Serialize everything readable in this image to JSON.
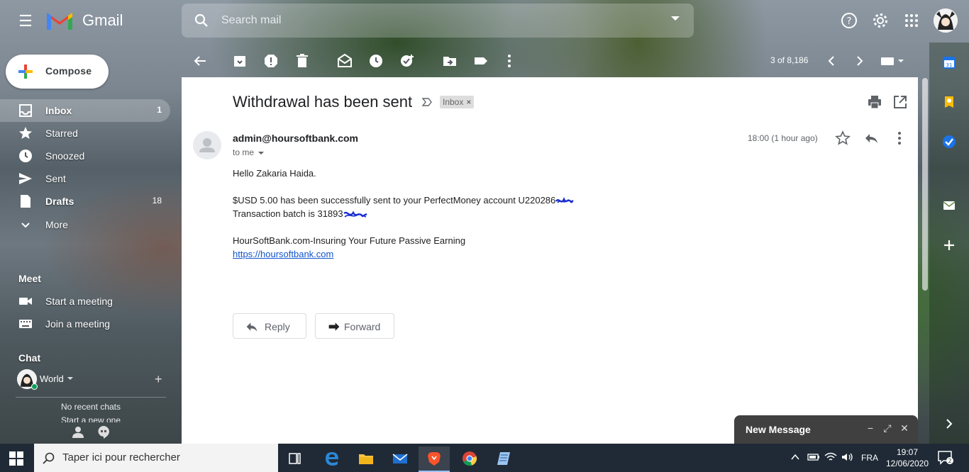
{
  "app": {
    "brand": "Gmail"
  },
  "search": {
    "placeholder": "Search mail"
  },
  "sidebar": {
    "compose": "Compose",
    "items": [
      {
        "label": "Inbox",
        "count": "1",
        "icon": "inbox-icon"
      },
      {
        "label": "Starred",
        "count": "",
        "icon": "star-icon"
      },
      {
        "label": "Snoozed",
        "count": "",
        "icon": "clock-icon"
      },
      {
        "label": "Sent",
        "count": "",
        "icon": "send-icon"
      },
      {
        "label": "Drafts",
        "count": "18",
        "icon": "draft-icon"
      },
      {
        "label": "More",
        "count": "",
        "icon": "chevron-down-icon"
      }
    ],
    "meet_title": "Meet",
    "meet_items": [
      {
        "label": "Start a meeting",
        "icon": "video-icon"
      },
      {
        "label": "Join a meeting",
        "icon": "keyboard-icon"
      }
    ],
    "chat_title": "Chat",
    "chat_user": "World",
    "no_chats": "No recent chats",
    "start_new": "Start a new one"
  },
  "toolbar": {
    "pager": "3 of 8,186"
  },
  "email": {
    "subject": "Withdrawal has been sent",
    "label": "Inbox",
    "sender": "admin@hoursoftbank.com",
    "to": "to me",
    "time": "18:00 (1 hour ago)",
    "greeting": "Hello Zakaria Haida.",
    "line1": "$USD 5.00 has been successfully sent to your PerfectMoney account U220286",
    "line2": "Transaction batch is 31893",
    "footer": "HourSoftBank.com-Insuring Your Future Passive Earning",
    "link": "https://hoursoftbank.com"
  },
  "actions": {
    "reply": "Reply",
    "forward": "Forward"
  },
  "new_message": {
    "title": "New Message"
  },
  "taskbar": {
    "search_placeholder": "Taper ici pour rechercher",
    "lang": "FRA",
    "time": "19:07",
    "date": "12/06/2020",
    "notif_count": "2"
  },
  "colors": {
    "accent": "#1a73e8",
    "link": "#1155cc",
    "panel": "#ffffff",
    "new_message_bar": "#404040",
    "taskbar": "#1f2a36"
  }
}
